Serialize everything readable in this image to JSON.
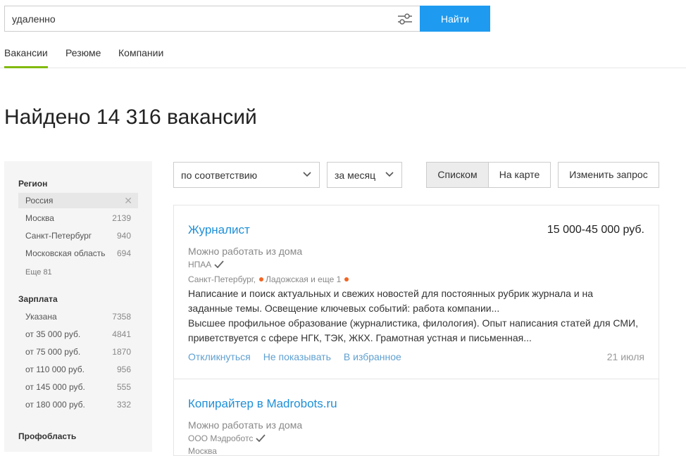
{
  "search": {
    "value": "удаленно",
    "button": "Найти"
  },
  "tabs": [
    {
      "label": "Вакансии"
    },
    {
      "label": "Резюме"
    },
    {
      "label": "Компании"
    }
  ],
  "page_title": "Найдено 14 316 вакансий",
  "sidebar": {
    "region": {
      "heading": "Регион",
      "items": [
        {
          "label": "Россия",
          "count": ""
        },
        {
          "label": "Москва",
          "count": "2139"
        },
        {
          "label": "Санкт-Петербург",
          "count": "940"
        },
        {
          "label": "Московская область",
          "count": "694"
        }
      ],
      "more": "Еще 81"
    },
    "salary": {
      "heading": "Зарплата",
      "items": [
        {
          "label": "Указана",
          "count": "7358"
        },
        {
          "label": "от 35 000 руб.",
          "count": "4841"
        },
        {
          "label": "от 75 000 руб.",
          "count": "1870"
        },
        {
          "label": "от 110 000 руб.",
          "count": "956"
        },
        {
          "label": "от 145 000 руб.",
          "count": "555"
        },
        {
          "label": "от 180 000 руб.",
          "count": "332"
        }
      ]
    },
    "profarea": {
      "heading": "Профобласть"
    }
  },
  "controls": {
    "sort": "по соответствию",
    "period": "за месяц",
    "view_list": "Списком",
    "view_map": "На карте",
    "change_query": "Изменить запрос"
  },
  "vacancies": [
    {
      "title": "Журналист",
      "salary": "15 000-45 000 руб.",
      "remote": "Можно работать из дома",
      "company": "НПАА",
      "location_city": "Санкт-Петербург,",
      "location_metro": "Ладожская и еще 1",
      "desc1": "Написание и поиск актуальных и свежих новостей для постоянных рубрик журнала и на заданные темы. Освещение ключевых событий: работа компании...",
      "desc2": "Высшее профильное образование (журналистика, филология). Опыт написания статей для СМИ, приветствуется с сфере НГК, ТЭК, ЖКХ. Грамотная устная и письменная...",
      "respond": "Откликнуться",
      "hide": "Не показывать",
      "favorite": "В избранное",
      "date": "21 июля"
    },
    {
      "title": "Копирайтер в Madrobots.ru",
      "remote": "Можно работать из дома",
      "company": "ООО Мэдроботс",
      "location_city": "Москва"
    }
  ]
}
